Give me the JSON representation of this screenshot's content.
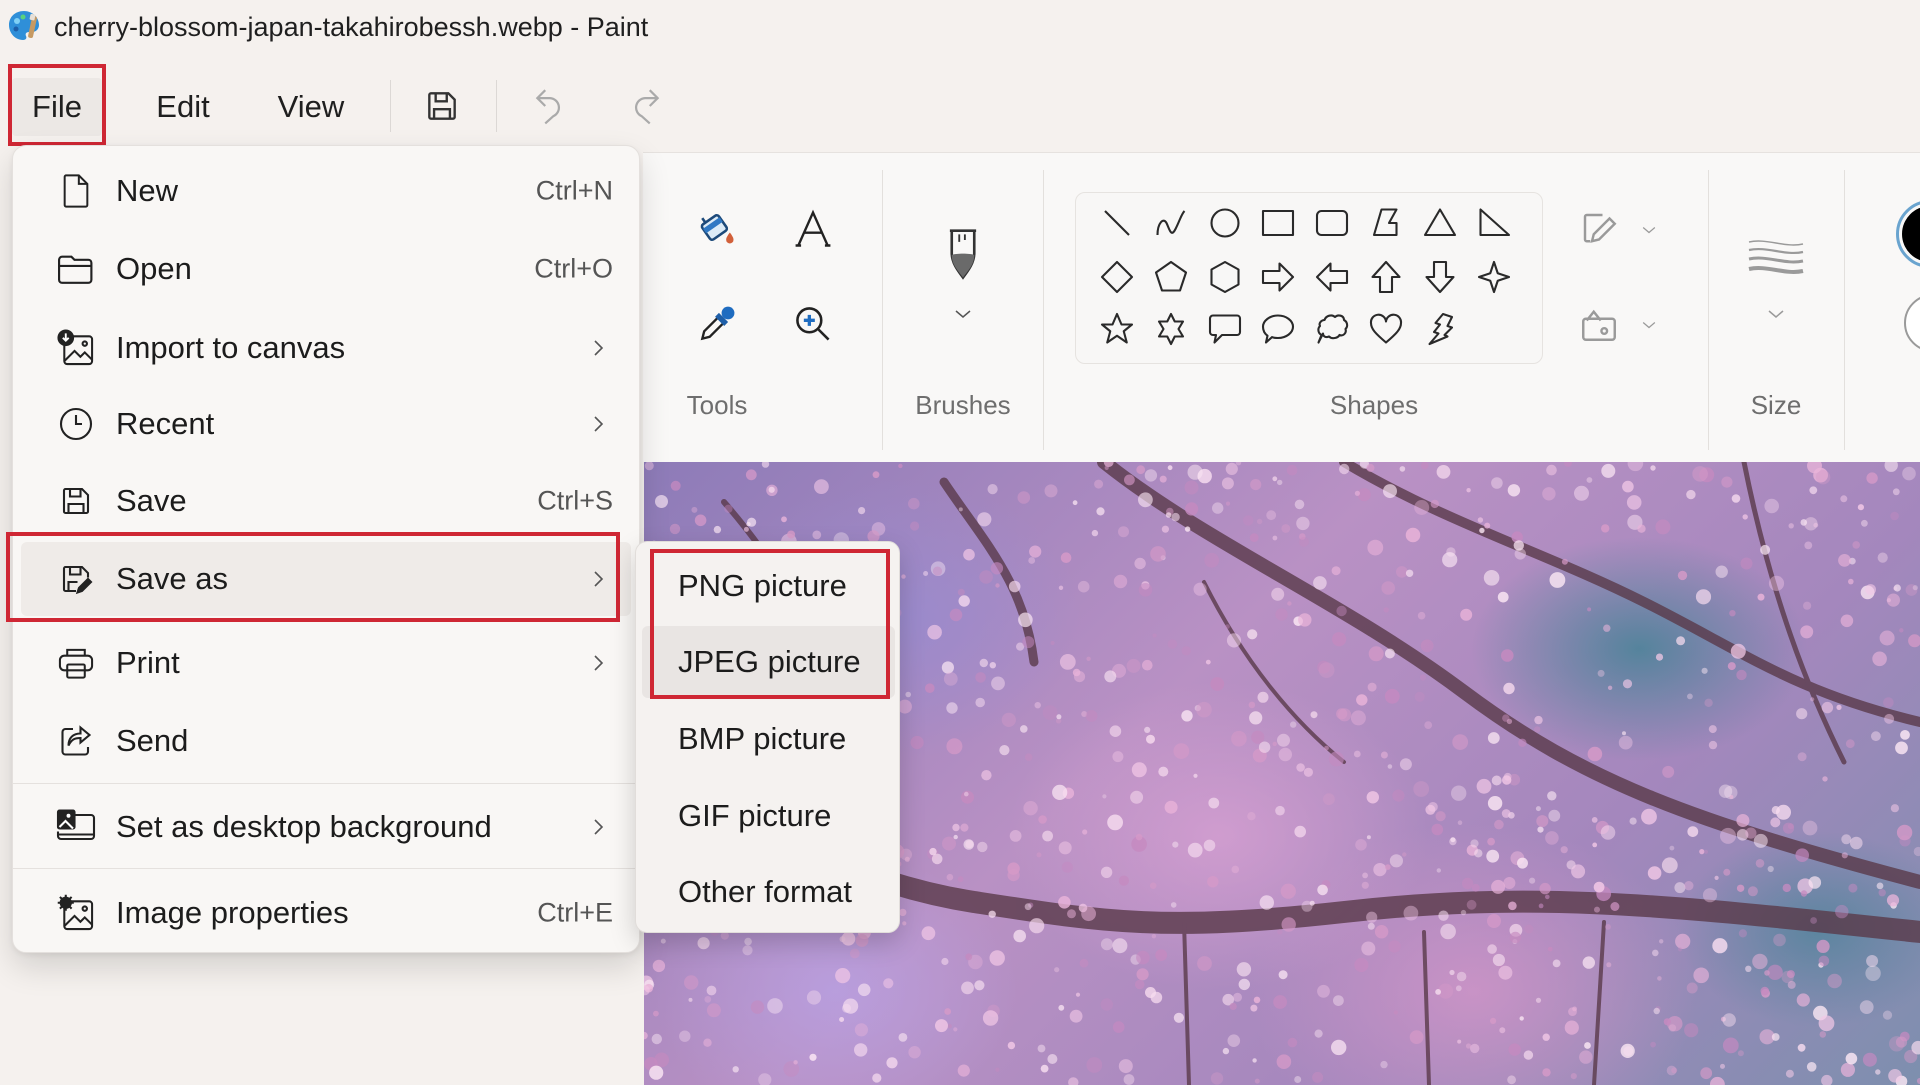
{
  "window": {
    "title": "cherry-blossom-japan-takahirobessh.webp - Paint",
    "app_icon": "paint-palette-icon"
  },
  "menubar": {
    "items": [
      {
        "label": "File",
        "highlighted": true
      },
      {
        "label": "Edit"
      },
      {
        "label": "View"
      }
    ],
    "quick_actions": [
      {
        "icon": "save-icon",
        "enabled": true
      },
      {
        "icon": "undo-icon",
        "enabled": false
      },
      {
        "icon": "redo-icon",
        "enabled": false
      }
    ]
  },
  "ribbon": {
    "groups": [
      {
        "label": "Tools",
        "tools": [
          "fill-bucket-icon",
          "text-icon",
          "color-picker-icon",
          "magnifier-icon"
        ]
      },
      {
        "label": "Brushes",
        "tools": [
          "brush-icon"
        ]
      },
      {
        "label": "Shapes",
        "shapes": [
          "line",
          "curve",
          "oval",
          "rectangle",
          "rounded-rectangle",
          "polygon",
          "triangle",
          "right-triangle",
          "diamond",
          "pentagon",
          "hexagon",
          "right-arrow",
          "left-arrow",
          "up-arrow",
          "down-arrow",
          "four-point-star",
          "five-point-star",
          "six-point-star",
          "rectangular-callout",
          "oval-callout",
          "cloud-callout",
          "heart",
          "lightning"
        ],
        "extras": [
          "shape-outline-icon",
          "shape-fill-icon"
        ]
      },
      {
        "label": "Size",
        "tools": [
          "stroke-size-icon"
        ]
      }
    ],
    "colors": {
      "primary": "#000000",
      "secondary": "#ffffff"
    }
  },
  "file_menu": {
    "items": [
      {
        "label": "New",
        "icon": "new-file-icon",
        "shortcut": "Ctrl+N"
      },
      {
        "label": "Open",
        "icon": "folder-icon",
        "shortcut": "Ctrl+O"
      },
      {
        "label": "Import to canvas",
        "icon": "import-image-icon",
        "submenu": true
      },
      {
        "label": "Recent",
        "icon": "clock-icon",
        "submenu": true
      },
      {
        "label": "Save",
        "icon": "save-icon",
        "shortcut": "Ctrl+S"
      },
      {
        "label": "Save as",
        "icon": "save-as-icon",
        "submenu": true,
        "highlighted": true
      },
      {
        "label": "Print",
        "icon": "printer-icon",
        "submenu": true
      },
      {
        "label": "Send",
        "icon": "share-icon"
      },
      {
        "label": "Set as desktop background",
        "icon": "desktop-background-icon",
        "submenu": true
      },
      {
        "label": "Image properties",
        "icon": "image-properties-icon",
        "shortcut": "Ctrl+E"
      }
    ]
  },
  "save_as_menu": {
    "items": [
      {
        "label": "PNG picture"
      },
      {
        "label": "JPEG picture",
        "hovered": true
      },
      {
        "label": "BMP picture"
      },
      {
        "label": "GIF picture"
      },
      {
        "label": "Other format"
      }
    ]
  },
  "annotation": {
    "highlight_color": "#cf2734"
  }
}
